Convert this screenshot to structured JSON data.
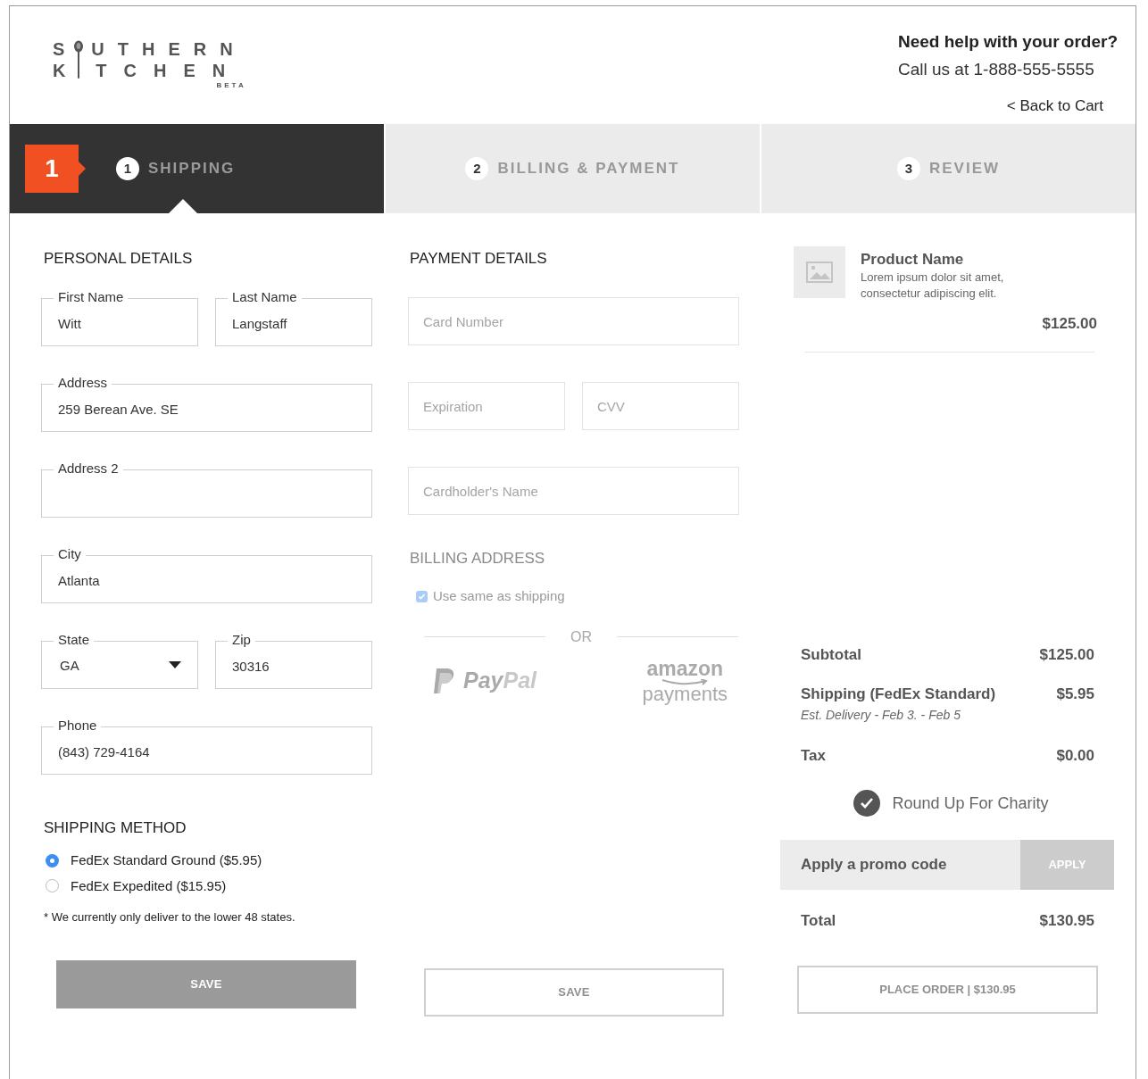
{
  "logo": {
    "row1_before": "S",
    "row1_after": "UTHERN",
    "row2_before": "K",
    "row2_after": "TCHEN",
    "tag": "BETA"
  },
  "help": {
    "title": "Need help with your order?",
    "phone_line": "Call us at 1-888-555-5555",
    "back_link": "< Back to Cart"
  },
  "current_step_badge": "1",
  "steps": [
    {
      "number": "1",
      "label": "SHIPPING",
      "selected": true
    },
    {
      "number": "2",
      "label": "BILLING & PAYMENT",
      "selected": false
    },
    {
      "number": "3",
      "label": "REVIEW",
      "selected": false
    }
  ],
  "personal_details": {
    "title": "PERSONAL DETAILS",
    "rows": [
      [
        {
          "kind": "text",
          "label": "First Name",
          "value": "Witt"
        },
        {
          "kind": "text",
          "label": "Last Name",
          "value": "Langstaff"
        }
      ],
      [
        {
          "kind": "text",
          "label": "Address",
          "value": "259 Berean Ave. SE"
        }
      ],
      [
        {
          "kind": "text",
          "label": "Address 2"
        }
      ],
      [
        {
          "kind": "text",
          "label": "City",
          "value": "Atlanta"
        }
      ],
      [
        {
          "kind": "select",
          "label": "State",
          "value": "GA"
        },
        {
          "kind": "text",
          "label": "Zip",
          "value": "30316"
        }
      ],
      [
        {
          "kind": "text",
          "label": "Phone",
          "value": "(843) 729-4164"
        }
      ]
    ]
  },
  "shipping_method": {
    "title": "SHIPPING METHOD",
    "options": [
      {
        "label": "FedEx Standard Ground ($5.95)",
        "selected": true
      },
      {
        "label": "FedEx Expedited ($15.95)",
        "selected": false
      }
    ],
    "note": "* We currently only deliver to the lower 48 states.",
    "button": {
      "label": "SAVE",
      "kind": "filled"
    }
  },
  "payment_details": {
    "title": "PAYMENT DETAILS",
    "rows": [
      [
        {
          "placeholder": "Card Number"
        }
      ],
      [
        {
          "placeholder": "Expiration"
        },
        {
          "placeholder": "CVV"
        }
      ],
      [
        {
          "placeholder": "Cardholder's Name"
        }
      ]
    ],
    "billing_title": "BILLING ADDRESS",
    "same_as_shipping": {
      "label": "Use same as shipping",
      "checked": true
    },
    "or_label": "OR",
    "alt_payments": [
      {
        "kind": "paypal",
        "parts": [
          "Pay",
          "Pal"
        ]
      },
      {
        "kind": "amazon",
        "parts": [
          "amazon",
          "payments"
        ]
      }
    ],
    "button": {
      "label": "SAVE",
      "kind": "outline"
    }
  },
  "order": {
    "product": {
      "name": "Product Name",
      "description": "Lorem ipsum dolor sit amet, consectetur adipiscing elit.",
      "price": "$125.00"
    },
    "lines": [
      {
        "label": "Subtotal",
        "value": "$125.00"
      },
      {
        "label": "Shipping (FedEx Standard)",
        "value": "$5.95",
        "note": "Est. Delivery - Feb 3. - Feb 5"
      },
      {
        "label": "Tax",
        "value": "$0.00"
      }
    ],
    "charity": {
      "label": "Round Up For Charity",
      "checked": true
    },
    "promo": {
      "placeholder": "Apply a promo code",
      "button": "APPLY"
    },
    "total": {
      "label": "Total",
      "value": "$130.95"
    },
    "button": {
      "label": "PLACE ORDER | $130.95",
      "kind": "outline"
    }
  }
}
